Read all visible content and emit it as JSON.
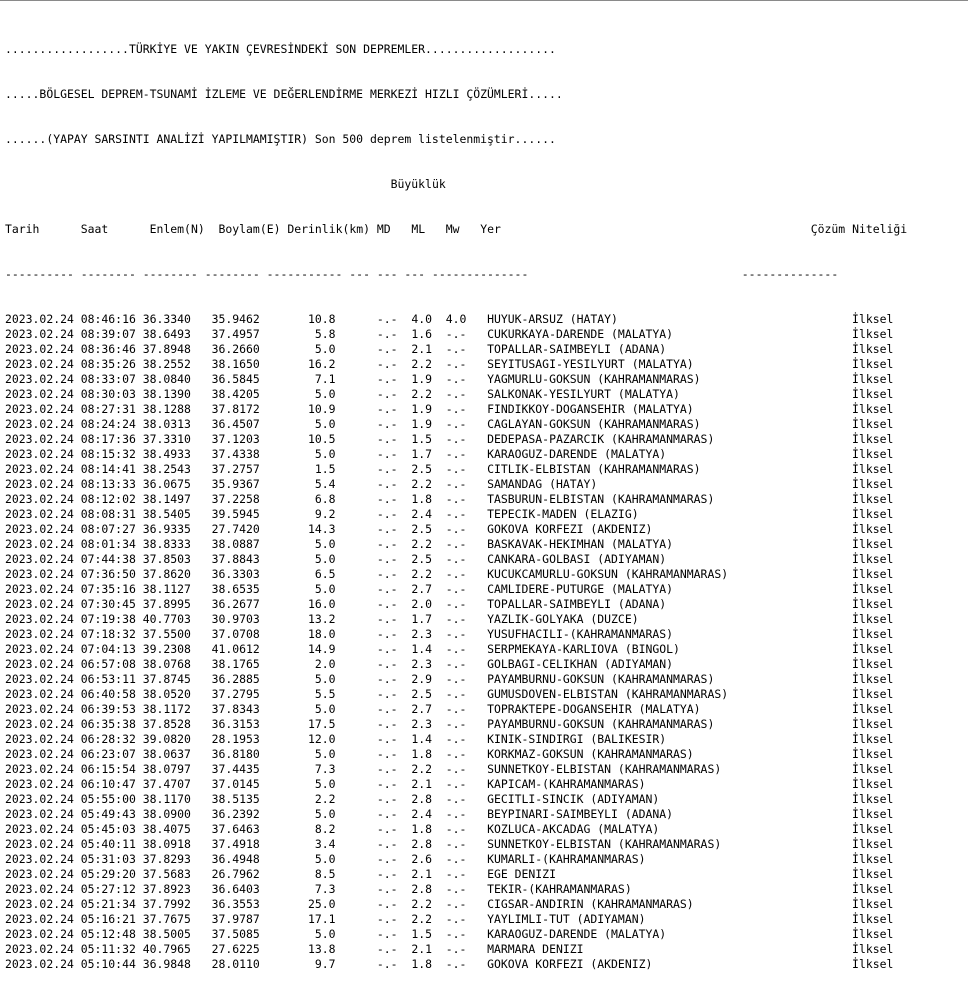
{
  "header": {
    "line1": "..................TÜRKİYE VE YAKIN ÇEVRESİNDEKİ SON DEPREMLER...................",
    "line2": ".....BÖLGESEL DEPREM-TSUNAMİ İZLEME VE DEĞERLENDİRME MERKEZİ HIZLI ÇÖZÜMLERİ.....",
    "line3": "......(YAPAY SARSINTI ANALİZİ YAPILMAMIŞTIR) Son 500 deprem listelenmiştir......"
  },
  "table": {
    "group_header": "Büyüklük",
    "columns": {
      "tarih": "Tarih",
      "saat": "Saat",
      "enlem": "Enlem(N)",
      "boylam": "Boylam(E)",
      "derinlik": "Derinlik(km)",
      "md": "MD",
      "ml": "ML",
      "mw": "Mw",
      "yer": "Yer",
      "cozum": "Çözüm Niteliği"
    },
    "rows": [
      {
        "tarih": "2023.02.24",
        "saat": "08:46:16",
        "enlem": "36.3340",
        "boylam": "35.9462",
        "derinlik": "10.8",
        "md": "-.-",
        "ml": "4.0",
        "mw": "4.0",
        "yer": "HUYUK-ARSUZ (HATAY)",
        "cozum": "İlksel"
      },
      {
        "tarih": "2023.02.24",
        "saat": "08:39:07",
        "enlem": "38.6493",
        "boylam": "37.4957",
        "derinlik": "5.8",
        "md": "-.-",
        "ml": "1.6",
        "mw": "-.-",
        "yer": "CUKURKAYA-DARENDE (MALATYA)",
        "cozum": "İlksel"
      },
      {
        "tarih": "2023.02.24",
        "saat": "08:36:46",
        "enlem": "37.8948",
        "boylam": "36.2660",
        "derinlik": "5.0",
        "md": "-.-",
        "ml": "2.1",
        "mw": "-.-",
        "yer": "TOPALLAR-SAIMBEYLI (ADANA)",
        "cozum": "İlksel"
      },
      {
        "tarih": "2023.02.24",
        "saat": "08:35:26",
        "enlem": "38.2552",
        "boylam": "38.1650",
        "derinlik": "16.2",
        "md": "-.-",
        "ml": "2.2",
        "mw": "-.-",
        "yer": "SEYITUSAGI-YESILYURT (MALATYA)",
        "cozum": "İlksel"
      },
      {
        "tarih": "2023.02.24",
        "saat": "08:33:07",
        "enlem": "38.0840",
        "boylam": "36.5845",
        "derinlik": "7.1",
        "md": "-.-",
        "ml": "1.9",
        "mw": "-.-",
        "yer": "YAGMURLU-GOKSUN (KAHRAMANMARAS)",
        "cozum": "İlksel"
      },
      {
        "tarih": "2023.02.24",
        "saat": "08:30:03",
        "enlem": "38.1390",
        "boylam": "38.4205",
        "derinlik": "5.0",
        "md": "-.-",
        "ml": "2.2",
        "mw": "-.-",
        "yer": "SALKONAK-YESILYURT (MALATYA)",
        "cozum": "İlksel"
      },
      {
        "tarih": "2023.02.24",
        "saat": "08:27:31",
        "enlem": "38.1288",
        "boylam": "37.8172",
        "derinlik": "10.9",
        "md": "-.-",
        "ml": "1.9",
        "mw": "-.-",
        "yer": "FINDIKKOY-DOGANSEHIR (MALATYA)",
        "cozum": "İlksel"
      },
      {
        "tarih": "2023.02.24",
        "saat": "08:24:24",
        "enlem": "38.0313",
        "boylam": "36.4507",
        "derinlik": "5.0",
        "md": "-.-",
        "ml": "1.9",
        "mw": "-.-",
        "yer": "CAGLAYAN-GOKSUN (KAHRAMANMARAS)",
        "cozum": "İlksel"
      },
      {
        "tarih": "2023.02.24",
        "saat": "08:17:36",
        "enlem": "37.3310",
        "boylam": "37.1203",
        "derinlik": "10.5",
        "md": "-.-",
        "ml": "1.5",
        "mw": "-.-",
        "yer": "DEDEPASA-PAZARCIK (KAHRAMANMARAS)",
        "cozum": "İlksel"
      },
      {
        "tarih": "2023.02.24",
        "saat": "08:15:32",
        "enlem": "38.4933",
        "boylam": "37.4338",
        "derinlik": "5.0",
        "md": "-.-",
        "ml": "1.7",
        "mw": "-.-",
        "yer": "KARAOGUZ-DARENDE (MALATYA)",
        "cozum": "İlksel"
      },
      {
        "tarih": "2023.02.24",
        "saat": "08:14:41",
        "enlem": "38.2543",
        "boylam": "37.2757",
        "derinlik": "1.5",
        "md": "-.-",
        "ml": "2.5",
        "mw": "-.-",
        "yer": "CITLIK-ELBISTAN (KAHRAMANMARAS)",
        "cozum": "İlksel"
      },
      {
        "tarih": "2023.02.24",
        "saat": "08:13:33",
        "enlem": "36.0675",
        "boylam": "35.9367",
        "derinlik": "5.4",
        "md": "-.-",
        "ml": "2.2",
        "mw": "-.-",
        "yer": "SAMANDAG (HATAY)",
        "cozum": "İlksel"
      },
      {
        "tarih": "2023.02.24",
        "saat": "08:12:02",
        "enlem": "38.1497",
        "boylam": "37.2258",
        "derinlik": "6.8",
        "md": "-.-",
        "ml": "1.8",
        "mw": "-.-",
        "yer": "TASBURUN-ELBISTAN (KAHRAMANMARAS)",
        "cozum": "İlksel"
      },
      {
        "tarih": "2023.02.24",
        "saat": "08:08:31",
        "enlem": "38.5405",
        "boylam": "39.5945",
        "derinlik": "9.2",
        "md": "-.-",
        "ml": "2.4",
        "mw": "-.-",
        "yer": "TEPECIK-MADEN (ELAZIG)",
        "cozum": "İlksel"
      },
      {
        "tarih": "2023.02.24",
        "saat": "08:07:27",
        "enlem": "36.9335",
        "boylam": "27.7420",
        "derinlik": "14.3",
        "md": "-.-",
        "ml": "2.5",
        "mw": "-.-",
        "yer": "GOKOVA KORFEZI (AKDENIZ)",
        "cozum": "İlksel"
      },
      {
        "tarih": "2023.02.24",
        "saat": "08:01:34",
        "enlem": "38.8333",
        "boylam": "38.0887",
        "derinlik": "5.0",
        "md": "-.-",
        "ml": "2.2",
        "mw": "-.-",
        "yer": "BASKAVAK-HEKIMHAN (MALATYA)",
        "cozum": "İlksel"
      },
      {
        "tarih": "2023.02.24",
        "saat": "07:44:38",
        "enlem": "37.8503",
        "boylam": "37.8843",
        "derinlik": "5.0",
        "md": "-.-",
        "ml": "2.5",
        "mw": "-.-",
        "yer": "CANKARA-GOLBASI (ADIYAMAN)",
        "cozum": "İlksel"
      },
      {
        "tarih": "2023.02.24",
        "saat": "07:36:50",
        "enlem": "37.8620",
        "boylam": "36.3303",
        "derinlik": "6.5",
        "md": "-.-",
        "ml": "2.2",
        "mw": "-.-",
        "yer": "KUCUKCAMURLU-GOKSUN (KAHRAMANMARAS)",
        "cozum": "İlksel"
      },
      {
        "tarih": "2023.02.24",
        "saat": "07:35:16",
        "enlem": "38.1127",
        "boylam": "38.6535",
        "derinlik": "5.0",
        "md": "-.-",
        "ml": "2.7",
        "mw": "-.-",
        "yer": "CAMLIDERE-PUTURGE (MALATYA)",
        "cozum": "İlksel"
      },
      {
        "tarih": "2023.02.24",
        "saat": "07:30:45",
        "enlem": "37.8995",
        "boylam": "36.2677",
        "derinlik": "16.0",
        "md": "-.-",
        "ml": "2.0",
        "mw": "-.-",
        "yer": "TOPALLAR-SAIMBEYLI (ADANA)",
        "cozum": "İlksel"
      },
      {
        "tarih": "2023.02.24",
        "saat": "07:19:38",
        "enlem": "40.7703",
        "boylam": "30.9703",
        "derinlik": "13.2",
        "md": "-.-",
        "ml": "1.7",
        "mw": "-.-",
        "yer": "YAZLIK-GOLYAKA (DUZCE)",
        "cozum": "İlksel"
      },
      {
        "tarih": "2023.02.24",
        "saat": "07:18:32",
        "enlem": "37.5500",
        "boylam": "37.0708",
        "derinlik": "18.0",
        "md": "-.-",
        "ml": "2.3",
        "mw": "-.-",
        "yer": "YUSUFHACILI-(KAHRAMANMARAS)",
        "cozum": "İlksel"
      },
      {
        "tarih": "2023.02.24",
        "saat": "07:04:13",
        "enlem": "39.2308",
        "boylam": "41.0612",
        "derinlik": "14.9",
        "md": "-.-",
        "ml": "1.4",
        "mw": "-.-",
        "yer": "SERPMEKAYA-KARLIOVA (BINGOL)",
        "cozum": "İlksel"
      },
      {
        "tarih": "2023.02.24",
        "saat": "06:57:08",
        "enlem": "38.0768",
        "boylam": "38.1765",
        "derinlik": "2.0",
        "md": "-.-",
        "ml": "2.3",
        "mw": "-.-",
        "yer": "GOLBAGI-CELIKHAN (ADIYAMAN)",
        "cozum": "İlksel"
      },
      {
        "tarih": "2023.02.24",
        "saat": "06:53:11",
        "enlem": "37.8745",
        "boylam": "36.2885",
        "derinlik": "5.0",
        "md": "-.-",
        "ml": "2.9",
        "mw": "-.-",
        "yer": "PAYAMBURNU-GOKSUN (KAHRAMANMARAS)",
        "cozum": "İlksel"
      },
      {
        "tarih": "2023.02.24",
        "saat": "06:40:58",
        "enlem": "38.0520",
        "boylam": "37.2795",
        "derinlik": "5.5",
        "md": "-.-",
        "ml": "2.5",
        "mw": "-.-",
        "yer": "GUMUSDOVEN-ELBISTAN (KAHRAMANMARAS)",
        "cozum": "İlksel"
      },
      {
        "tarih": "2023.02.24",
        "saat": "06:39:53",
        "enlem": "38.1172",
        "boylam": "37.8343",
        "derinlik": "5.0",
        "md": "-.-",
        "ml": "2.7",
        "mw": "-.-",
        "yer": "TOPRAKTEPE-DOGANSEHIR (MALATYA)",
        "cozum": "İlksel"
      },
      {
        "tarih": "2023.02.24",
        "saat": "06:35:38",
        "enlem": "37.8528",
        "boylam": "36.3153",
        "derinlik": "17.5",
        "md": "-.-",
        "ml": "2.3",
        "mw": "-.-",
        "yer": "PAYAMBURNU-GOKSUN (KAHRAMANMARAS)",
        "cozum": "İlksel"
      },
      {
        "tarih": "2023.02.24",
        "saat": "06:28:32",
        "enlem": "39.0820",
        "boylam": "28.1953",
        "derinlik": "12.0",
        "md": "-.-",
        "ml": "1.4",
        "mw": "-.-",
        "yer": "KINIK-SINDIRGI (BALIKESIR)",
        "cozum": "İlksel"
      },
      {
        "tarih": "2023.02.24",
        "saat": "06:23:07",
        "enlem": "38.0637",
        "boylam": "36.8180",
        "derinlik": "5.0",
        "md": "-.-",
        "ml": "1.8",
        "mw": "-.-",
        "yer": "KORKMAZ-GOKSUN (KAHRAMANMARAS)",
        "cozum": "İlksel"
      },
      {
        "tarih": "2023.02.24",
        "saat": "06:15:54",
        "enlem": "38.0797",
        "boylam": "37.4435",
        "derinlik": "7.3",
        "md": "-.-",
        "ml": "2.2",
        "mw": "-.-",
        "yer": "SUNNETKOY-ELBISTAN (KAHRAMANMARAS)",
        "cozum": "İlksel"
      },
      {
        "tarih": "2023.02.24",
        "saat": "06:10:47",
        "enlem": "37.4707",
        "boylam": "37.0145",
        "derinlik": "5.0",
        "md": "-.-",
        "ml": "2.1",
        "mw": "-.-",
        "yer": "KAPICAM-(KAHRAMANMARAS)",
        "cozum": "İlksel"
      },
      {
        "tarih": "2023.02.24",
        "saat": "05:55:00",
        "enlem": "38.1170",
        "boylam": "38.5135",
        "derinlik": "2.2",
        "md": "-.-",
        "ml": "2.8",
        "mw": "-.-",
        "yer": "GECITLI-SINCIK (ADIYAMAN)",
        "cozum": "İlksel"
      },
      {
        "tarih": "2023.02.24",
        "saat": "05:49:43",
        "enlem": "38.0900",
        "boylam": "36.2392",
        "derinlik": "5.0",
        "md": "-.-",
        "ml": "2.4",
        "mw": "-.-",
        "yer": "BEYPINARI-SAIMBEYLI (ADANA)",
        "cozum": "İlksel"
      },
      {
        "tarih": "2023.02.24",
        "saat": "05:45:03",
        "enlem": "38.4075",
        "boylam": "37.6463",
        "derinlik": "8.2",
        "md": "-.-",
        "ml": "1.8",
        "mw": "-.-",
        "yer": "KOZLUCA-AKCADAG (MALATYA)",
        "cozum": "İlksel"
      },
      {
        "tarih": "2023.02.24",
        "saat": "05:40:11",
        "enlem": "38.0918",
        "boylam": "37.4918",
        "derinlik": "3.4",
        "md": "-.-",
        "ml": "2.8",
        "mw": "-.-",
        "yer": "SUNNETKOY-ELBISTAN (KAHRAMANMARAS)",
        "cozum": "İlksel"
      },
      {
        "tarih": "2023.02.24",
        "saat": "05:31:03",
        "enlem": "37.8293",
        "boylam": "36.4948",
        "derinlik": "5.0",
        "md": "-.-",
        "ml": "2.6",
        "mw": "-.-",
        "yer": "KUMARLI-(KAHRAMANMARAS)",
        "cozum": "İlksel"
      },
      {
        "tarih": "2023.02.24",
        "saat": "05:29:20",
        "enlem": "37.5683",
        "boylam": "26.7962",
        "derinlik": "8.5",
        "md": "-.-",
        "ml": "2.1",
        "mw": "-.-",
        "yer": "EGE DENIZI",
        "cozum": "İlksel"
      },
      {
        "tarih": "2023.02.24",
        "saat": "05:27:12",
        "enlem": "37.8923",
        "boylam": "36.6403",
        "derinlik": "7.3",
        "md": "-.-",
        "ml": "2.8",
        "mw": "-.-",
        "yer": "TEKIR-(KAHRAMANMARAS)",
        "cozum": "İlksel"
      },
      {
        "tarih": "2023.02.24",
        "saat": "05:21:34",
        "enlem": "37.7992",
        "boylam": "36.3553",
        "derinlik": "25.0",
        "md": "-.-",
        "ml": "2.2",
        "mw": "-.-",
        "yer": "CIGSAR-ANDIRIN (KAHRAMANMARAS)",
        "cozum": "İlksel"
      },
      {
        "tarih": "2023.02.24",
        "saat": "05:16:21",
        "enlem": "37.7675",
        "boylam": "37.9787",
        "derinlik": "17.1",
        "md": "-.-",
        "ml": "2.2",
        "mw": "-.-",
        "yer": "YAYLIMLI-TUT (ADIYAMAN)",
        "cozum": "İlksel"
      },
      {
        "tarih": "2023.02.24",
        "saat": "05:12:48",
        "enlem": "38.5005",
        "boylam": "37.5085",
        "derinlik": "5.0",
        "md": "-.-",
        "ml": "1.5",
        "mw": "-.-",
        "yer": "KARAOGUZ-DARENDE (MALATYA)",
        "cozum": "İlksel"
      },
      {
        "tarih": "2023.02.24",
        "saat": "05:11:32",
        "enlem": "40.7965",
        "boylam": "27.6225",
        "derinlik": "13.8",
        "md": "-.-",
        "ml": "2.1",
        "mw": "-.-",
        "yer": "MARMARA DENIZI",
        "cozum": "İlksel"
      },
      {
        "tarih": "2023.02.24",
        "saat": "05:10:44",
        "enlem": "36.9848",
        "boylam": "28.0110",
        "derinlik": "9.7",
        "md": "-.-",
        "ml": "1.8",
        "mw": "-.-",
        "yer": "GOKOVA KORFEZI (AKDENIZ)",
        "cozum": "İlksel"
      }
    ]
  }
}
